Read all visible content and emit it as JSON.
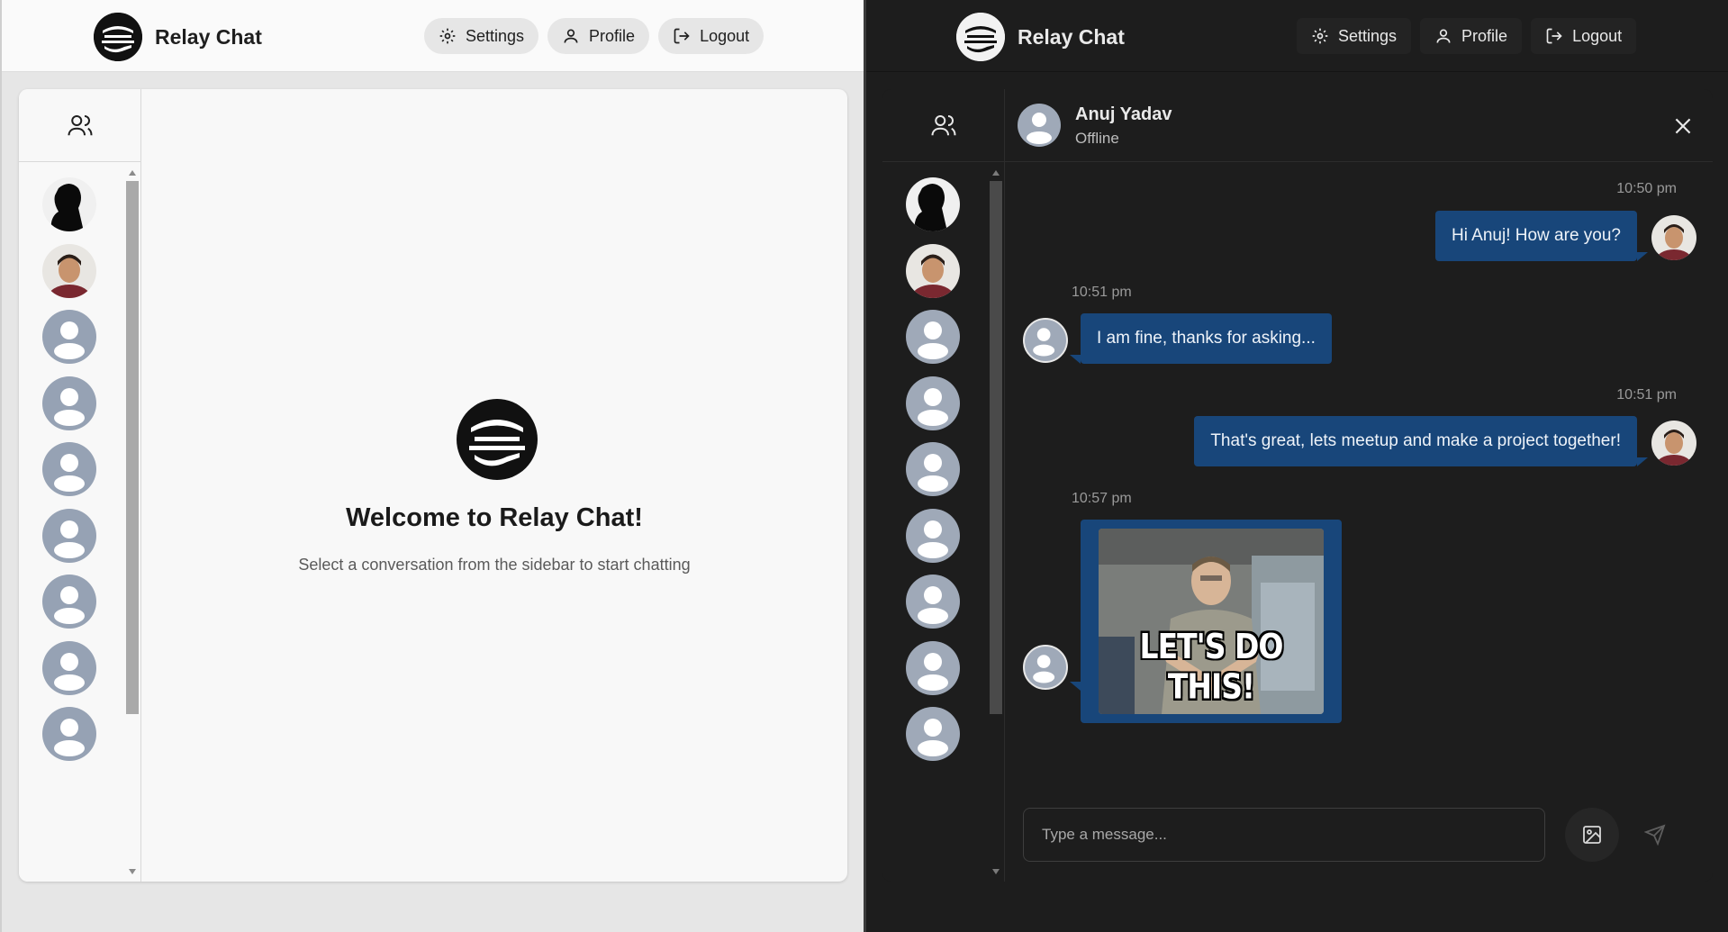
{
  "app": {
    "name": "Relay Chat"
  },
  "nav": {
    "settings": "Settings",
    "profile": "Profile",
    "logout": "Logout"
  },
  "welcome": {
    "title": "Welcome to Relay Chat!",
    "subtitle": "Select a conversation from the sidebar to start chatting"
  },
  "sidebar": {
    "icon": "users-icon",
    "contacts": [
      {
        "avatar": "silhouette"
      },
      {
        "avatar": "photo"
      },
      {
        "avatar": "generic"
      },
      {
        "avatar": "generic"
      },
      {
        "avatar": "generic"
      },
      {
        "avatar": "generic"
      },
      {
        "avatar": "generic"
      },
      {
        "avatar": "generic"
      },
      {
        "avatar": "generic"
      }
    ]
  },
  "chat": {
    "name": "Anuj Yadav",
    "status": "Offline",
    "messages": [
      {
        "time": "10:50 pm",
        "text": "Hi Anuj! How are you?",
        "from": "me"
      },
      {
        "time": "10:51 pm",
        "text": "I am fine, thanks for asking...",
        "from": "them"
      },
      {
        "time": "10:51 pm",
        "text": "That's great, lets meetup and make a project together!",
        "from": "me"
      },
      {
        "time": "10:57 pm",
        "gif_caption": "LET'S DO THIS!",
        "from": "them"
      }
    ],
    "composer": {
      "placeholder": "Type a message..."
    }
  },
  "colors": {
    "bubble": "#18467a",
    "dark_bg": "#1d1d1d",
    "light_card": "#f8f8f8"
  }
}
